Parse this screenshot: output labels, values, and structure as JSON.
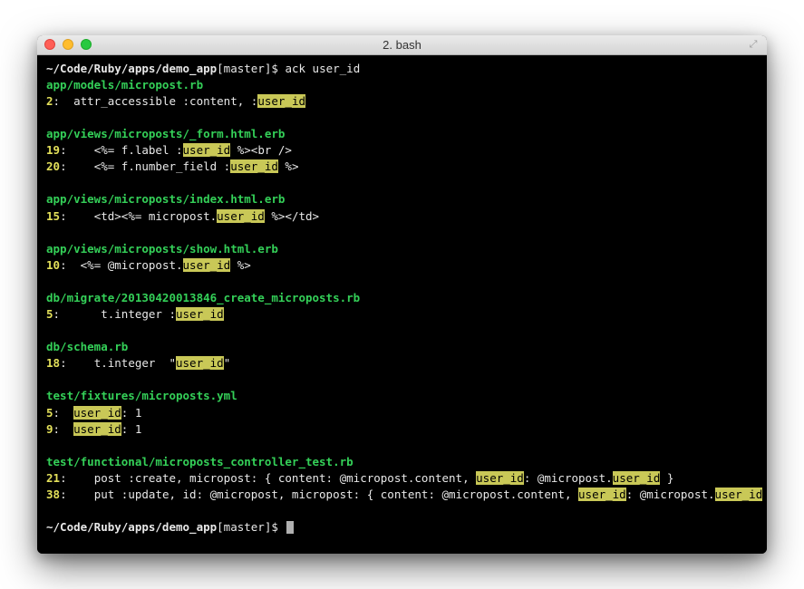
{
  "window": {
    "title": "2. bash"
  },
  "prompt": {
    "path": "~/Code/Ruby/apps/demo_app",
    "branch_open": "[",
    "branch": "master",
    "branch_close": "]",
    "symbol": "$",
    "command": "ack user_id"
  },
  "results": [
    {
      "file": "app/models/micropost.rb",
      "lines": [
        {
          "no": "2",
          "pre": ":  attr_accessible :content, :",
          "match": "user_id",
          "post": ""
        }
      ]
    },
    {
      "file": "app/views/microposts/_form.html.erb",
      "lines": [
        {
          "no": "19",
          "pre": ":    <%= f.label :",
          "match": "user_id",
          "post": " %><br />"
        },
        {
          "no": "20",
          "pre": ":    <%= f.number_field :",
          "match": "user_id",
          "post": " %>"
        }
      ]
    },
    {
      "file": "app/views/microposts/index.html.erb",
      "lines": [
        {
          "no": "15",
          "pre": ":    <td><%= micropost.",
          "match": "user_id",
          "post": " %></td>"
        }
      ]
    },
    {
      "file": "app/views/microposts/show.html.erb",
      "lines": [
        {
          "no": "10",
          "pre": ":  <%= @micropost.",
          "match": "user_id",
          "post": " %>"
        }
      ]
    },
    {
      "file": "db/migrate/20130420013846_create_microposts.rb",
      "lines": [
        {
          "no": "5",
          "pre": ":      t.integer :",
          "match": "user_id",
          "post": ""
        }
      ]
    },
    {
      "file": "db/schema.rb",
      "lines": [
        {
          "no": "18",
          "pre": ":    t.integer  \"",
          "match": "user_id",
          "post": "\""
        }
      ]
    },
    {
      "file": "test/fixtures/microposts.yml",
      "lines": [
        {
          "no": "5",
          "pre": ":  ",
          "match": "user_id",
          "post": ": 1"
        },
        {
          "no": "9",
          "pre": ":  ",
          "match": "user_id",
          "post": ": 1"
        }
      ]
    },
    {
      "file": "test/functional/microposts_controller_test.rb",
      "lines": [
        {
          "no": "21",
          "segments": [
            {
              "t": "text",
              "v": ":    post :create, micropost: { content: @micropost.content, "
            },
            {
              "t": "hl",
              "v": "user_id"
            },
            {
              "t": "text",
              "v": ": @micropost."
            },
            {
              "t": "hl",
              "v": "user_id"
            },
            {
              "t": "text",
              "v": " }"
            }
          ]
        },
        {
          "no": "38",
          "segments": [
            {
              "t": "text",
              "v": ":    put :update, id: @micropost, micropost: { content: @micropost.content, "
            },
            {
              "t": "hl",
              "v": "user_id"
            },
            {
              "t": "text",
              "v": ": @micropost."
            },
            {
              "t": "hl",
              "v": "user_id"
            },
            {
              "t": "text",
              "v": " }"
            }
          ]
        }
      ]
    }
  ]
}
